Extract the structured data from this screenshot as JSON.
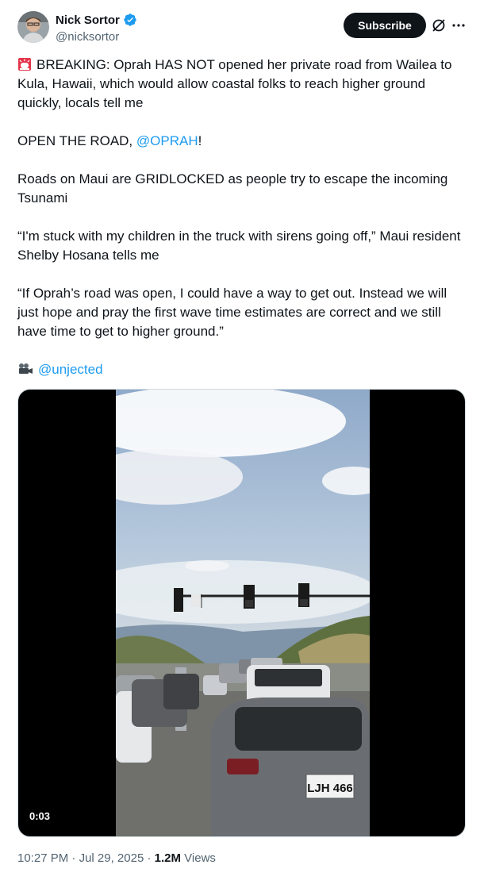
{
  "author": {
    "display_name": "Nick Sortor",
    "handle": "@nicksortor"
  },
  "header": {
    "subscribe_label": "Subscribe"
  },
  "tweet": {
    "para1": "BREAKING: Oprah HAS NOT opened her private road from Wailea to Kula, Hawaii, which would allow coastal folks to reach higher ground quickly, locals tell me",
    "para2_prefix": "OPEN THE ROAD, ",
    "para2_mention": "@OPRAH",
    "para2_suffix": "!",
    "para3": "Roads on Maui are GRIDLOCKED as people try to escape the incoming Tsunami",
    "para4": "“I'm stuck with my children in the truck with sirens going off,” Maui resident Shelby Hosana tells me",
    "para5": "“If Oprah’s road was open, I could have a way to get out. Instead we will just hope and pray the first wave time estimates are correct and we still have time to get to higher ground.”",
    "credit_mention": "@unjected"
  },
  "video": {
    "timecode": "0:03",
    "plate": "LJH 466"
  },
  "meta": {
    "time": "10:27 PM",
    "separator": " · ",
    "date": "Jul 29, 2025",
    "views_count": "1.2M",
    "views_label": " Views"
  },
  "icons": {
    "verified": "verified-badge-icon",
    "grok": "grok-icon",
    "more": "more-icon",
    "siren": "siren-emoji-icon",
    "camera": "movie-camera-emoji-icon"
  },
  "colors": {
    "accent": "#1d9bf0",
    "text": "#0f1419",
    "muted": "#536471"
  }
}
